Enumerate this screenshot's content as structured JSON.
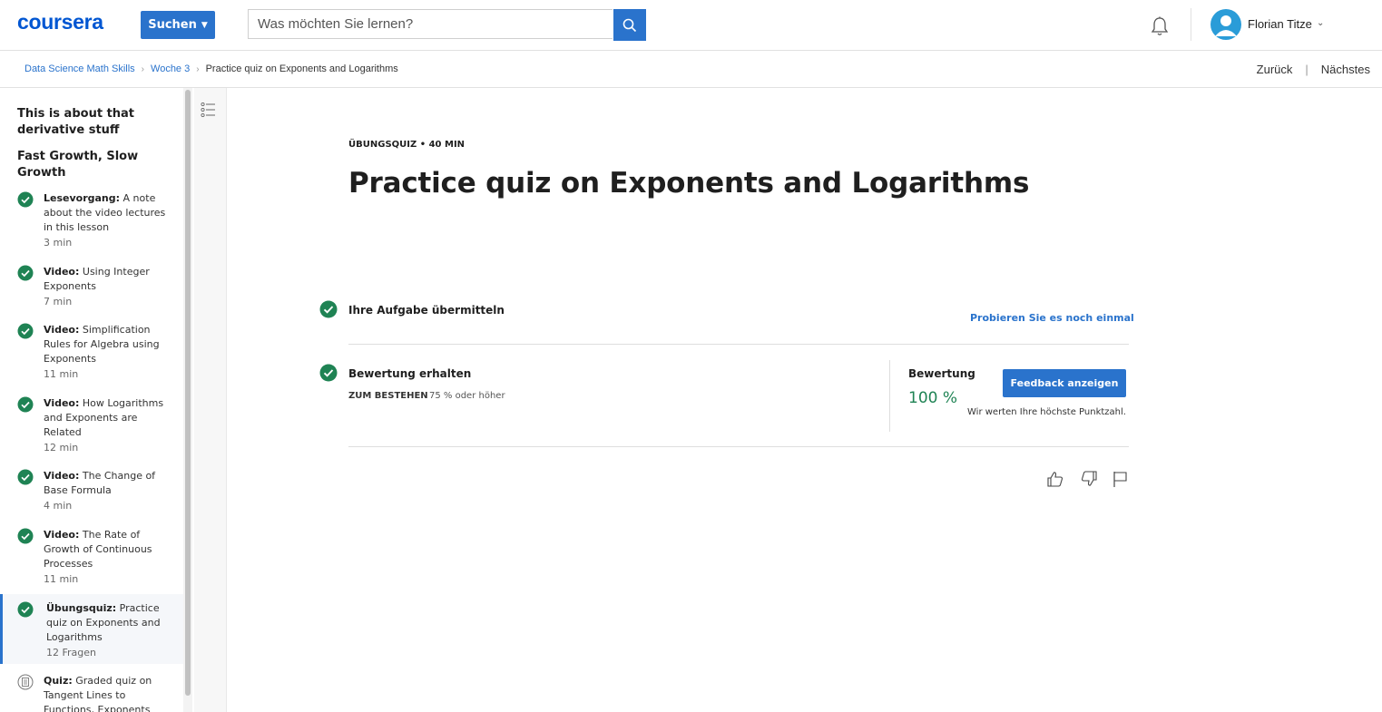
{
  "header": {
    "logo": "coursera",
    "search_button_label": "Suchen",
    "search_placeholder": "Was möchten Sie lernen?",
    "user_name": "Florian Titze"
  },
  "breadcrumb": {
    "items": [
      "Data Science Math Skills",
      "Woche 3"
    ],
    "current": "Practice quiz on Exponents and Logarithms",
    "back_label": "Zurück",
    "next_label": "Nächstes"
  },
  "sidebar": {
    "sections": [
      "This is about that derivative stuff",
      "Fast Growth, Slow Growth"
    ],
    "items": [
      {
        "type": "Lesevorgang:",
        "title": "A note about the video lectures in this lesson",
        "meta": "3 min"
      },
      {
        "type": "Video:",
        "title": "Using Integer Exponents",
        "meta": "7 min"
      },
      {
        "type": "Video:",
        "title": "Simplification Rules for Algebra using Exponents",
        "meta": "11 min"
      },
      {
        "type": "Video:",
        "title": "How Logarithms and Exponents are Related",
        "meta": "12 min"
      },
      {
        "type": "Video:",
        "title": "The Change of Base Formula",
        "meta": "4 min"
      },
      {
        "type": "Video:",
        "title": "The Rate of Growth of Continuous Processes",
        "meta": "11 min"
      },
      {
        "type": "Übungsquiz:",
        "title": "Practice quiz on Exponents and Logarithms",
        "meta": "12 Fragen"
      },
      {
        "type": "Quiz:",
        "title": "Graded quiz on Tangent Lines to Functions, Exponents and",
        "meta": ""
      }
    ]
  },
  "main": {
    "kicker": "ÜBUNGSQUIZ • 40 MIN",
    "title": "Practice quiz on Exponents and Logarithms",
    "submit_row_title": "Ihre Aufgabe übermitteln",
    "retry_label": "Probieren Sie es noch einmal",
    "grade_row_title": "Bewertung erhalten",
    "pass_label": "ZUM BESTEHEN",
    "pass_value": "75 % oder höher",
    "grade_label": "Bewertung",
    "grade_value": "100 %",
    "feedback_button": "Feedback anzeigen",
    "grade_note": "Wir werten Ihre höchste Punktzahl."
  },
  "colors": {
    "accent": "#2a73cc",
    "success": "#1f8354",
    "brand": "#0056d2"
  },
  "icons": [
    "search-icon",
    "bell-icon",
    "avatar-icon",
    "check-icon",
    "quiz-icon",
    "outline-list-icon",
    "thumbs-up-icon",
    "thumbs-down-icon",
    "flag-icon"
  ]
}
